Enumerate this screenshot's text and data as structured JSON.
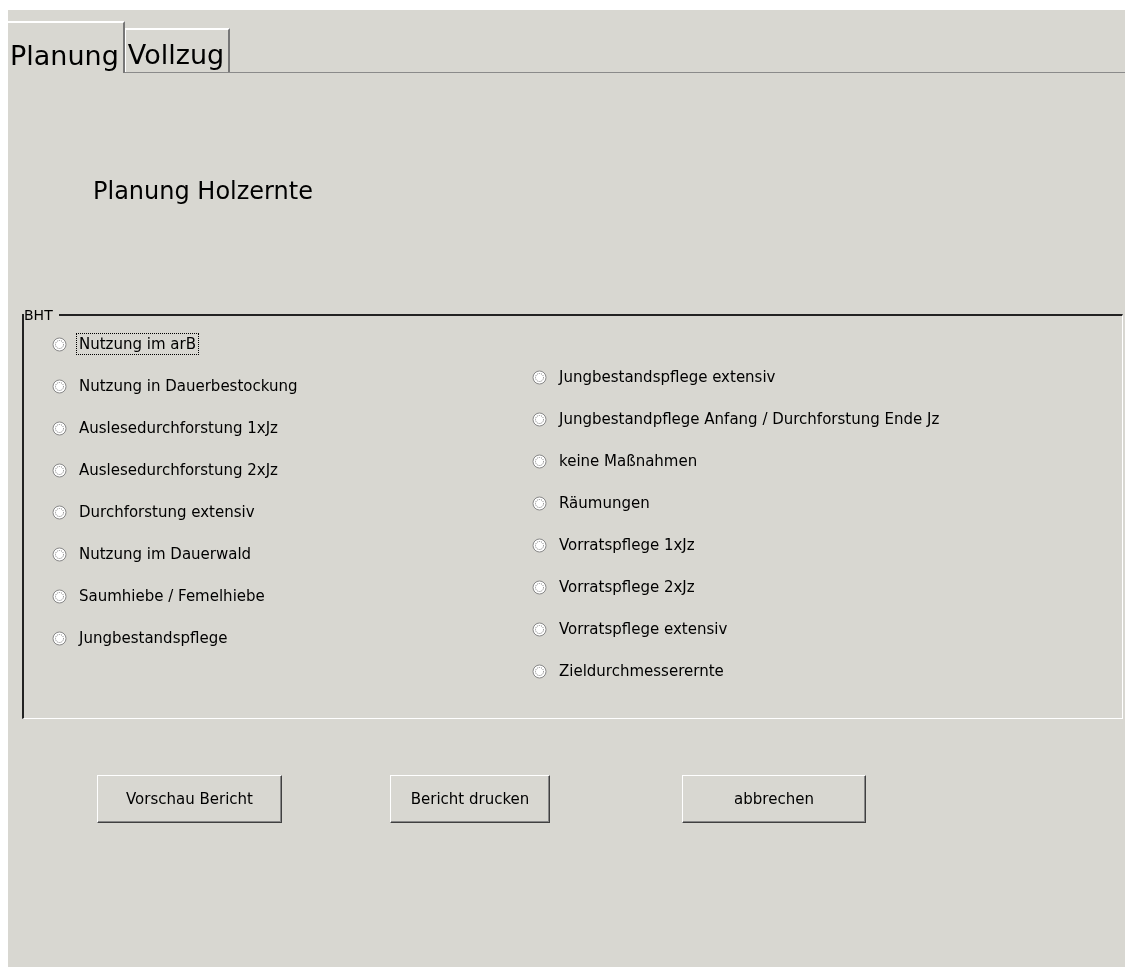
{
  "tabs": [
    {
      "label": "Planung",
      "selected": true
    },
    {
      "label": "Vollzug",
      "selected": false
    }
  ],
  "heading": "Planung Holzernte",
  "group": {
    "title": "BHT",
    "left_options": [
      {
        "label": "Nutzung im arB",
        "selected": false,
        "focused": true
      },
      {
        "label": "Nutzung in Dauerbestockung",
        "selected": false,
        "focused": false
      },
      {
        "label": "Auslesedurchforstung 1xJz",
        "selected": false,
        "focused": false
      },
      {
        "label": "Auslesedurchforstung 2xJz",
        "selected": false,
        "focused": false
      },
      {
        "label": "Durchforstung extensiv",
        "selected": false,
        "focused": false
      },
      {
        "label": "Nutzung im Dauerwald",
        "selected": false,
        "focused": false
      },
      {
        "label": "Saumhiebe / Femelhiebe",
        "selected": false,
        "focused": false
      },
      {
        "label": "Jungbestandspflege",
        "selected": false,
        "focused": false
      }
    ],
    "right_options": [
      {
        "label": "Jungbestandspflege extensiv",
        "selected": false,
        "focused": false
      },
      {
        "label": "Jungbestandpflege Anfang / Durchforstung Ende Jz",
        "selected": false,
        "focused": false
      },
      {
        "label": "keine Maßnahmen",
        "selected": false,
        "focused": false
      },
      {
        "label": "Räumungen",
        "selected": false,
        "focused": false
      },
      {
        "label": "Vorratspflege 1xJz",
        "selected": false,
        "focused": false
      },
      {
        "label": "Vorratspflege 2xJz",
        "selected": false,
        "focused": false
      },
      {
        "label": "Vorratspflege extensiv",
        "selected": false,
        "focused": false
      },
      {
        "label": "Zieldurchmesserernte",
        "selected": false,
        "focused": false
      }
    ]
  },
  "buttons": [
    "Vorschau Bericht",
    "Bericht drucken",
    "abbrechen"
  ]
}
